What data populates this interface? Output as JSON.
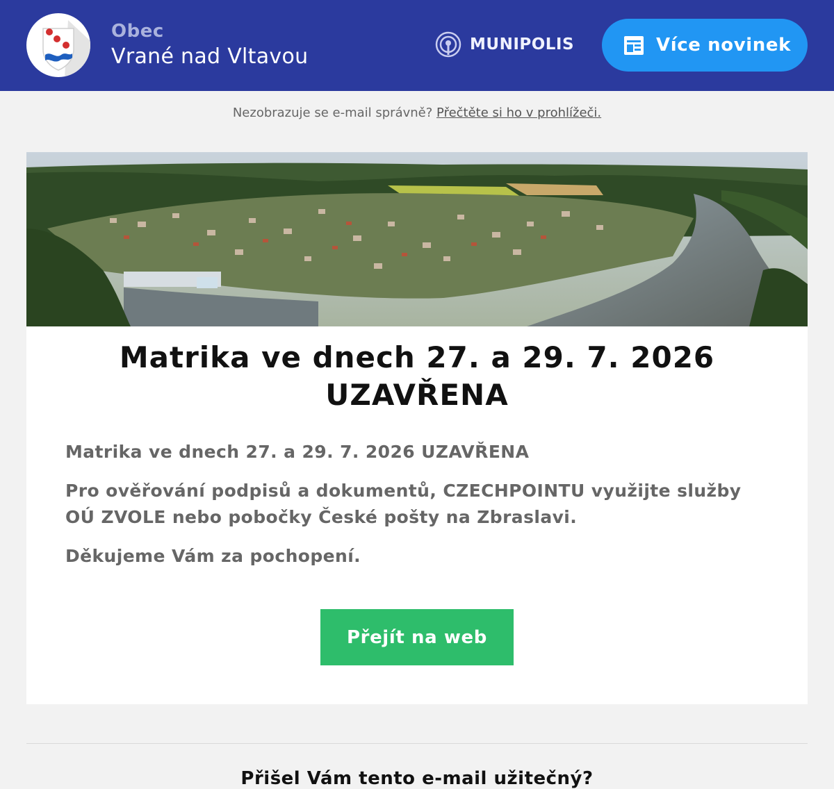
{
  "header": {
    "obec_label": "Obec",
    "town_name": "Vrané nad Vltavou",
    "brand": "MUNIPOLIS",
    "more_news_label": "Více novinek",
    "accent_color": "#2b3a9e",
    "button_color": "#2196f3"
  },
  "notice": {
    "text": "Nezobrazuje se e-mail správně?",
    "link": "Přečtěte si ho v prohlížeči."
  },
  "article": {
    "headline_line1": "Matrika ve dnech 27. a 29. 7. 2026",
    "headline_line2": "UZAVŘENA",
    "paragraphs": [
      "Matrika ve dnech 27. a 29. 7. 2026 UZAVŘENA",
      "Pro ověřování podpisů a dokumentů, CZECHPOINTU využijte služby OÚ ZVOLE nebo pobočky České pošty na Zbraslavi.",
      "Děkujeme Vám za pochopení."
    ],
    "cta_label": "Přejít na web",
    "cta_color": "#2ebd6b"
  },
  "footer": {
    "question": "Přišel Vám tento e-mail užitečný?"
  },
  "icons": [
    "crest-logo",
    "broadcast-icon",
    "newspaper-icon"
  ]
}
